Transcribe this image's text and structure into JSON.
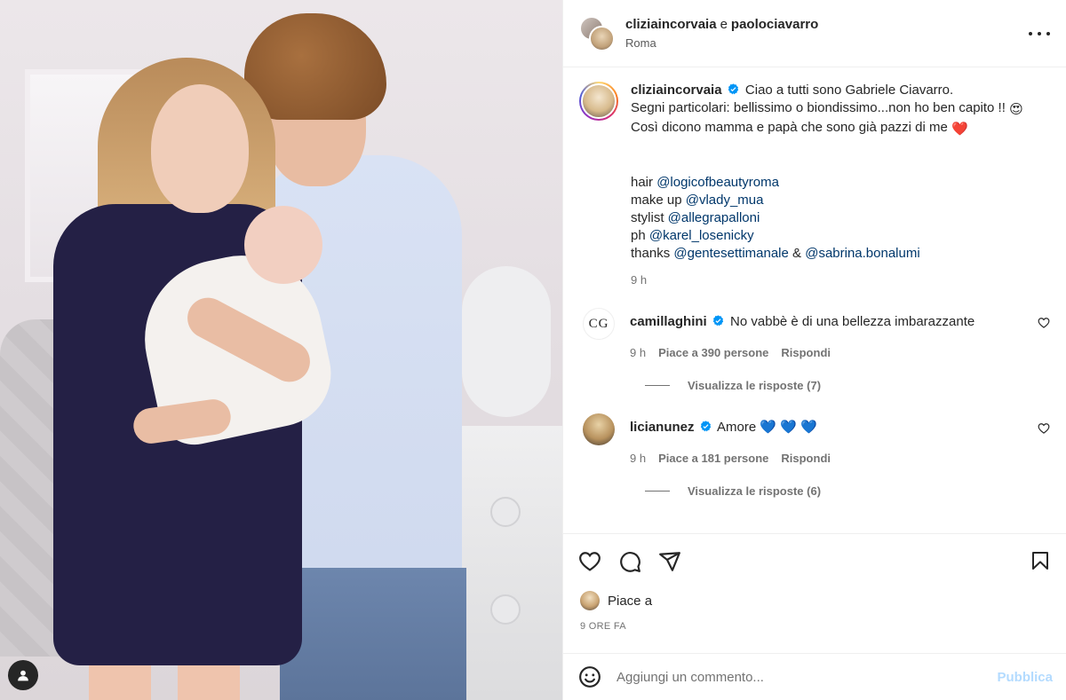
{
  "post": {
    "photo_alt": "",
    "account_icon": "user-icon"
  },
  "header": {
    "user1": "cliziaincorvaia",
    "conjunction": "e",
    "user2": "paolociavarro",
    "location": "Roma",
    "more_icon": "more-horizontal-icon"
  },
  "caption": {
    "username": "cliziaincorvaia",
    "line1": "Ciao a tutti sono Gabriele Ciavarro.",
    "line2": "Segni particolari: bellissimo o biondissimo...non ho ben capito !!",
    "line2_emoji": "😍",
    "line3": "Così dicono mamma e papà che sono già pazzi di me",
    "line3_emoji": "❤️",
    "credits": [
      {
        "label": "hair",
        "mention": "@logicofbeautyroma"
      },
      {
        "label": "make up",
        "mention": "@vlady_mua"
      },
      {
        "label": "stylist",
        "mention": "@allegrapalloni"
      },
      {
        "label": "ph",
        "mention": "@karel_losenicky"
      }
    ],
    "thanks_label": "thanks",
    "thanks_mention1": "@gentesettimanale",
    "thanks_amp": "&",
    "thanks_mention2": "@sabrina.bonalumi",
    "time": "9 h"
  },
  "comments": [
    {
      "avatar_text": "CG",
      "username": "camillaghini",
      "text": "No vabbè è di una bellezza imbarazzante",
      "time": "9 h",
      "likes": "Piace a 390 persone",
      "reply": "Rispondi",
      "view_replies": "Visualizza le risposte (7)"
    },
    {
      "avatar_text": "",
      "username": "licianunez",
      "text": "Amore",
      "emojis": "💙 💙 💙",
      "time": "9 h",
      "likes": "Piace a 181 persone",
      "reply": "Rispondi",
      "view_replies": "Visualizza le risposte (6)"
    }
  ],
  "actions": {
    "like_icon": "heart-icon",
    "comment_icon": "comment-icon",
    "share_icon": "share-icon",
    "save_icon": "bookmark-icon",
    "likes_text": "Piace a",
    "time_ago": "9 ORE FA"
  },
  "comment_bar": {
    "emoji_icon": "emoji-icon",
    "placeholder": "Aggiungi un commento...",
    "publish": "Pubblica"
  },
  "colors": {
    "verified": "#0095f6",
    "mention": "#00376b",
    "publish_disabled": "#b3dbff",
    "heart_red": "#ed4956",
    "blue_heart": "#1877c9"
  }
}
